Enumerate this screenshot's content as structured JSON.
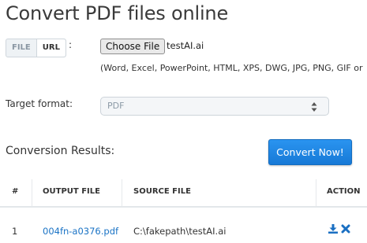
{
  "page": {
    "title": "Convert PDF files online"
  },
  "source": {
    "tabs": [
      {
        "label": "FILE"
      },
      {
        "label": "URL"
      }
    ],
    "colon": ":",
    "choose_button_label": "Choose File",
    "chosen_file": "testAI.ai",
    "formats_text": "(Word, Excel, PowerPoint, HTML, XPS, DWG, JPG, PNG, GIF or"
  },
  "target": {
    "label": "Target format:",
    "selected": "PDF"
  },
  "results": {
    "label": "Conversion Results:",
    "convert_button_label": "Convert Now!",
    "columns": [
      "#",
      "OUTPUT FILE",
      "SOURCE FILE",
      "ACTION"
    ],
    "rows": [
      {
        "index": "1",
        "output_file": "004fn-a0376.pdf",
        "source_file": "C:\\fakepath\\testAI.ai"
      }
    ]
  },
  "colors": {
    "accent": "#1a7fe0",
    "link": "#1a73c5",
    "icon": "#1a6fc2"
  },
  "icons": [
    "download-icon",
    "delete-icon",
    "select-arrows-icon"
  ]
}
